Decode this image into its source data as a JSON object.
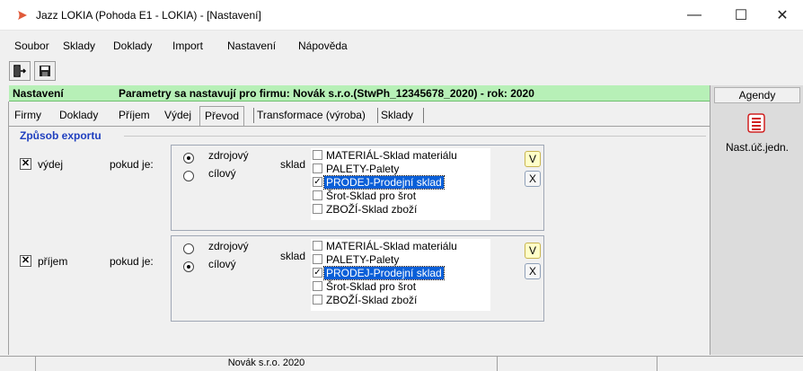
{
  "window": {
    "title": "Jazz LOKIA (Pohoda E1 - LOKIA) - [Nastavení]",
    "min_label": "—",
    "max_label": "☐",
    "close_label": "✕"
  },
  "menu": [
    {
      "label": "Soubor"
    },
    {
      "label": "Sklady"
    },
    {
      "label": "Doklady"
    },
    {
      "label": "Import"
    },
    {
      "label": "Nastavení"
    },
    {
      "label": "Nápověda"
    }
  ],
  "toolbar": {
    "exit_icon": "exit-door-icon",
    "save_icon": "floppy-save-icon"
  },
  "header": {
    "label": "Nastavení",
    "info": "Parametry sa nastavují pro firmu: Novák s.r.o.(StwPh_12345678_2020) - rok: 2020"
  },
  "tabs": [
    {
      "label": "Firmy"
    },
    {
      "label": "Doklady"
    },
    {
      "label": "Příjem"
    },
    {
      "label": "Výdej"
    },
    {
      "label": "Převod",
      "active": true
    },
    {
      "label": "Transformace (výroba)"
    },
    {
      "label": "Sklady"
    }
  ],
  "group": {
    "title": "Způsob exportu"
  },
  "vydej": {
    "label": "výdej",
    "checked": true,
    "mark": "✕",
    "pokud": "pokud je:",
    "radio_zdroj": "zdrojový",
    "radio_cil": "cílový",
    "selected": "zdrojový",
    "sklad": "sklad",
    "items": [
      "MATERIÁL-Sklad materiálu",
      "PALETY-Palety",
      "PRODEJ-Prodejní sklad",
      "Šrot-Sklad pro šrot",
      "ZBOŽÍ-Sklad zboží"
    ],
    "checked_items": [
      "PRODEJ-Prodejní sklad"
    ],
    "check_mark": "✓",
    "btn_v": "V",
    "btn_x": "X"
  },
  "prijem": {
    "label": "příjem",
    "checked": true,
    "mark": "✕",
    "pokud": "pokud je:",
    "radio_zdroj": "zdrojový",
    "radio_cil": "cílový",
    "selected": "cílový",
    "sklad": "sklad",
    "items": [
      "MATERIÁL-Sklad materiálu",
      "PALETY-Palety",
      "PRODEJ-Prodejní sklad",
      "Šrot-Sklad pro šrot",
      "ZBOŽÍ-Sklad zboží"
    ],
    "checked_items": [
      "PRODEJ-Prodejní sklad"
    ],
    "check_mark": "✓",
    "btn_v": "V",
    "btn_x": "X"
  },
  "agendy": {
    "title": "Agendy",
    "item_label": "Nast.úč.jedn.",
    "item_icon": "accounting-settings-icon"
  },
  "statusbar": {
    "company": "Novák s.r.o. 2020"
  },
  "colors": {
    "header_green": "#b7f0b7",
    "group_title": "#1f3fbf",
    "selection": "#0a5fd8",
    "app_icon": "#e05a3a"
  }
}
